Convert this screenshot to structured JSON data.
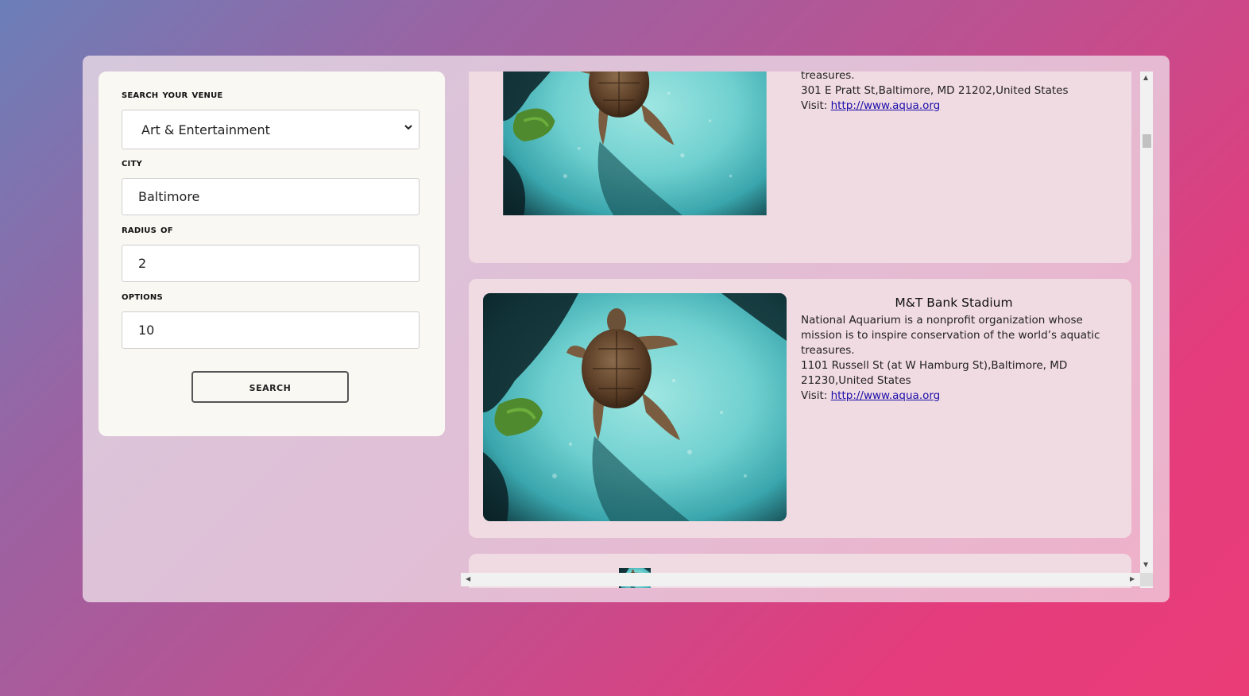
{
  "form": {
    "venue_label": "search your venue",
    "venue_value": "Art & Entertainment",
    "city_label": "city",
    "city_value": "Baltimore",
    "radius_label": "radius of",
    "radius_value": "2",
    "options_label": "options",
    "options_value": "10",
    "search_label": "search"
  },
  "results": [
    {
      "title": "",
      "description": "treasures.",
      "address": "301 E Pratt St,Baltimore, MD 21202,United States",
      "visit_prefix": "Visit: ",
      "link": "http://www.aqua.org"
    },
    {
      "title": "M&T Bank Stadium",
      "description": "National Aquarium is a nonprofit organization whose mission is to inspire conservation of the world’s aquatic treasures.",
      "address": "1101 Russell St (at W Hamburg St),Baltimore, MD 21230,United States",
      "visit_prefix": "Visit: ",
      "link": "http://www.aqua.org"
    }
  ],
  "icons": {
    "select_arrow": "chevron-down-icon",
    "scroll_up": "arrow-up-icon",
    "scroll_down": "arrow-down-icon",
    "scroll_left": "arrow-left-icon",
    "scroll_right": "arrow-right-icon"
  },
  "colors": {
    "page_gradient_start": "#6b7fb8",
    "page_gradient_end": "#ea3d78",
    "form_card_bg": "#faf8f3",
    "result_card_bg": "#f1dbe2",
    "link": "#1a0dab"
  }
}
